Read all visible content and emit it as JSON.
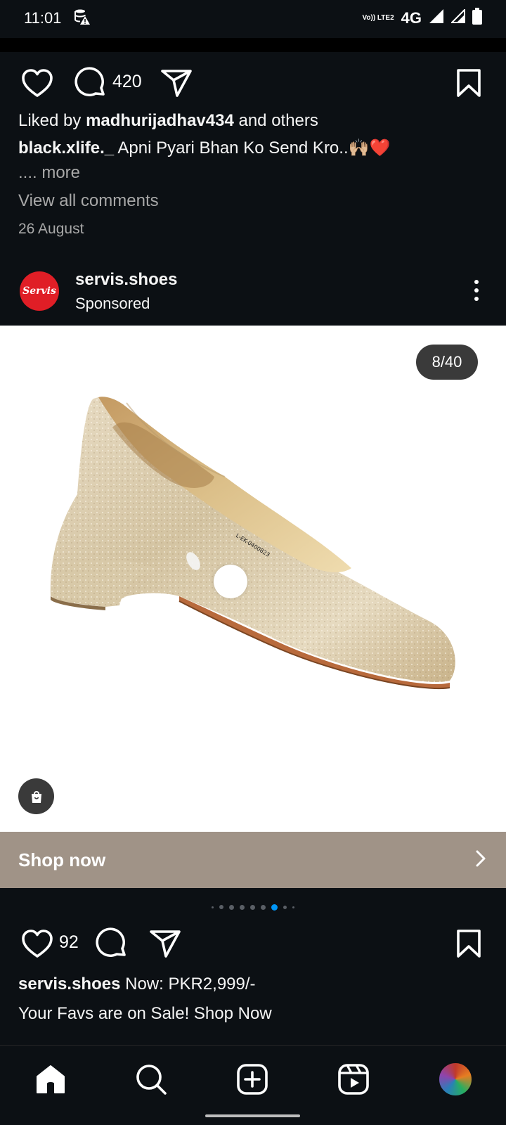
{
  "status_bar": {
    "time": "11:01",
    "network_label": "Vo)) LTE2",
    "network_type": "4G"
  },
  "post1": {
    "comment_count": "420",
    "liked_by_prefix": "Liked by ",
    "liked_by_user": "madhurijadhav434",
    "liked_by_suffix": " and others",
    "caption_user": "black.xlife._",
    "caption_text": " Apni Pyari Bhan Ko Send Kro..🙌🏼❤️",
    "more_label": ".... more",
    "view_all_comments": "View all comments",
    "date": "26 August"
  },
  "sponsored_post": {
    "account_logo_text": "Servis",
    "account_name": "servis.shoes",
    "sponsored_label": "Sponsored",
    "carousel_position": "8/40",
    "carousel_index": 8,
    "carousel_total": 40,
    "shoe_label_text": "L-EK-0400823",
    "cta_label": "Shop now",
    "like_count": "92",
    "caption_user": "servis.shoes",
    "caption_text": " Now: PKR2,999/-",
    "caption_line2": "Your Favs are on Sale! Shop Now"
  },
  "bottom_nav": {
    "items": [
      "home-icon",
      "search-icon",
      "create-icon",
      "reels-icon",
      "profile-avatar"
    ]
  },
  "colors": {
    "background": "#0c1014",
    "cta_bar": "#a09387",
    "active_dot": "#0095f6",
    "logo_red": "#e01e26"
  }
}
